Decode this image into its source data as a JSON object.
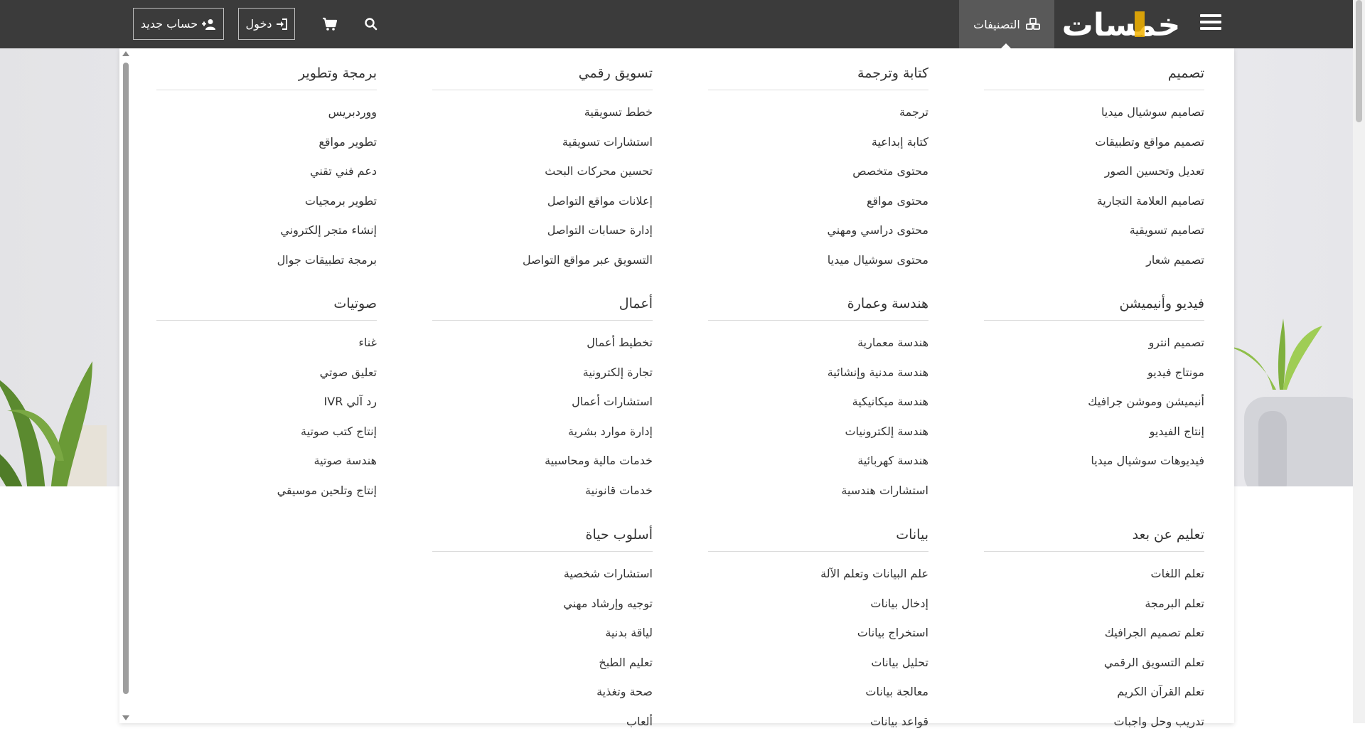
{
  "navbar": {
    "brand_name": "خمسات",
    "categories_label": "التصنيفات",
    "login_label": "دخول",
    "register_label": "حساب جديد",
    "colors": {
      "bar": "#3b3b3b",
      "active_tab": "#595959",
      "brand_accent": "#f4b400"
    }
  },
  "categories": [
    {
      "title": "تصميم",
      "items": [
        "تصاميم سوشيال ميديا",
        "تصميم مواقع وتطبيقات",
        "تعديل وتحسين الصور",
        "تصاميم العلامة التجارية",
        "تصاميم تسويقية",
        "تصميم شعار"
      ]
    },
    {
      "title": "كتابة وترجمة",
      "items": [
        "ترجمة",
        "كتابة إبداعية",
        "محتوى متخصص",
        "محتوى مواقع",
        "محتوى دراسي ومهني",
        "محتوى سوشيال ميديا"
      ]
    },
    {
      "title": "تسويق رقمي",
      "items": [
        "خطط تسويقية",
        "استشارات تسويقية",
        "تحسين محركات البحث",
        "إعلانات مواقع التواصل",
        "إدارة حسابات التواصل",
        "التسويق عبر مواقع التواصل"
      ]
    },
    {
      "title": "برمجة وتطوير",
      "items": [
        "ووردبريس",
        "تطوير مواقع",
        "دعم فني تقني",
        "تطوير برمجيات",
        "إنشاء متجر إلكتروني",
        "برمجة تطبيقات جوال"
      ]
    },
    {
      "title": "فيديو وأنيميشن",
      "items": [
        "تصميم انترو",
        "مونتاج فيديو",
        "أنيميشن وموشن جرافيك",
        "إنتاج الفيديو",
        "فيديوهات سوشيال ميديا"
      ]
    },
    {
      "title": "هندسة وعمارة",
      "items": [
        "هندسة معمارية",
        "هندسة مدنية وإنشائية",
        "هندسة ميكانيكية",
        "هندسة إلكترونيات",
        "هندسة كهربائية",
        "استشارات هندسية"
      ]
    },
    {
      "title": "أعمال",
      "items": [
        "تخطيط أعمال",
        "تجارة إلكترونية",
        "استشارات أعمال",
        "إدارة موارد بشرية",
        "خدمات مالية ومحاسبية",
        "خدمات قانونية"
      ]
    },
    {
      "title": "صوتيات",
      "items": [
        "غناء",
        "تعليق صوتي",
        "رد آلي IVR",
        "إنتاج كتب صوتية",
        "هندسة صوتية",
        "إنتاج وتلحين موسيقي"
      ]
    },
    {
      "title": "تعليم عن بعد",
      "items": [
        "تعلم اللغات",
        "تعلم البرمجة",
        "تعلم تصميم الجرافيك",
        "تعلم التسويق الرقمي",
        "تعلم القرآن الكريم",
        "تدريب وحل واجبات"
      ]
    },
    {
      "title": "بيانات",
      "items": [
        "علم البيانات وتعلم الآلة",
        "إدخال بيانات",
        "استخراج بيانات",
        "تحليل بيانات",
        "معالجة بيانات",
        "قواعد بيانات"
      ]
    },
    {
      "title": "أسلوب حياة",
      "items": [
        "استشارات شخصية",
        "توجيه وإرشاد مهني",
        "لياقة بدنية",
        "تعليم الطبخ",
        "صحة وتغذية",
        "ألعاب"
      ]
    }
  ]
}
